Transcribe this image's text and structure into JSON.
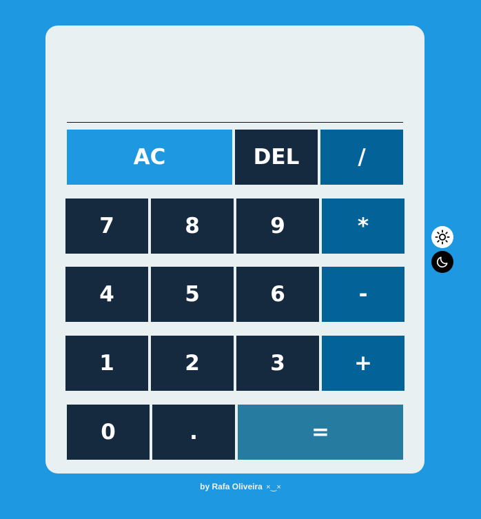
{
  "display": {
    "previous": "",
    "current": ""
  },
  "buttons": {
    "ac": "AC",
    "del": "DEL",
    "divide": "/",
    "seven": "7",
    "eight": "8",
    "nine": "9",
    "multiply": "*",
    "four": "4",
    "five": "5",
    "six": "6",
    "subtract": "-",
    "one": "1",
    "two": "2",
    "three": "3",
    "add": "+",
    "zero": "0",
    "decimal": ".",
    "equals": "="
  },
  "theme": {
    "light_icon": "sun-icon",
    "dark_icon": "moon-icon"
  },
  "footer": {
    "credit": "by Rafa Oliveira",
    "emoji": "×‿×"
  },
  "colors": {
    "background": "#1e98e0",
    "panel": "#e8f0f2",
    "digit": "#15293f",
    "operator": "#036297",
    "clear": "#1e98e0",
    "equals": "#257ba0"
  }
}
